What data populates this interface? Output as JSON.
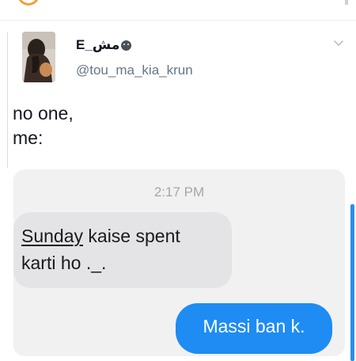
{
  "tweet": {
    "display_name": "E_مش",
    "handle": "@tou_ma_kia_krun",
    "text_lines": [
      "no one,",
      "me:"
    ],
    "avatar_icon": "profile-photo",
    "menu_icon": "chevron-down-icon"
  },
  "chat": {
    "timestamp": "2:17 PM",
    "received_underlined": "Sunday",
    "received_rest_line1": " kaise spent",
    "received_line2": "karti ho ._.",
    "sent": "Massi ban k."
  },
  "colors": {
    "sent_bubble": "#1e8cf2",
    "received_bubble": "#e4e4e7",
    "card_bg": "#f1f1f2",
    "handle": "#657786"
  }
}
